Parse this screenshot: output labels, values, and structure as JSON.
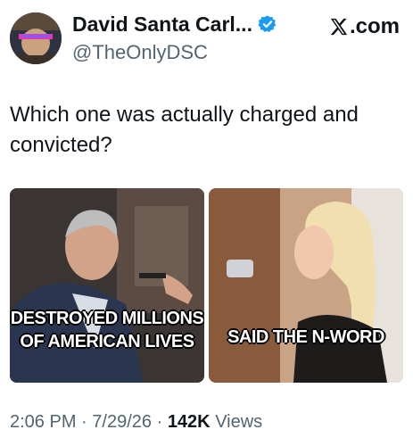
{
  "header": {
    "display_name": "David Santa Carl...",
    "handle": "@TheOnlyDSC",
    "site_label": ".com"
  },
  "tweet": {
    "text": "Which one was actually charged and convicted?"
  },
  "media": {
    "left_caption_line1": "DESTROYED MILLIONS",
    "left_caption_line2": "OF AMERICAN LIVES",
    "right_caption": "SAID THE N-WORD"
  },
  "meta": {
    "time": "2:06 PM",
    "date": "7/29/26",
    "views_count": "142K",
    "views_label": "Views",
    "separator": "·"
  },
  "colors": {
    "verified_blue": "#1d9bf0",
    "secondary_text": "#536471"
  }
}
